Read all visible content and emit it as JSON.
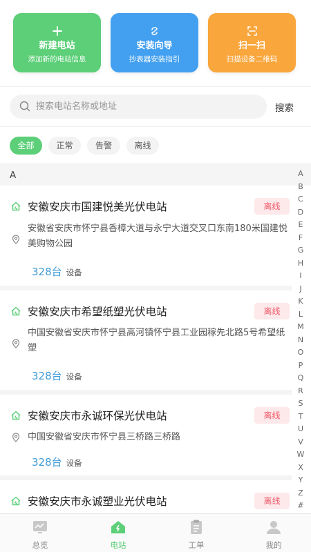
{
  "actions": [
    {
      "title": "新建电站",
      "subtitle": "添加新的电站信息",
      "icon": "plus-icon",
      "color": "#5ccf78"
    },
    {
      "title": "安装向导",
      "subtitle": "抄表器安装指引",
      "icon": "guide-icon",
      "color": "#43a0f0"
    },
    {
      "title": "扫一扫",
      "subtitle": "扫描设备二维码",
      "icon": "scan-icon",
      "color": "#f9a63c"
    }
  ],
  "search": {
    "placeholder": "搜索电站名称或地址",
    "button": "搜索"
  },
  "filters": {
    "all": "全部",
    "normal": "正常",
    "alarm": "告警",
    "offline": "离线",
    "active": "全部"
  },
  "section_letter": "A",
  "stations": [
    {
      "name": "安徽安庆市国建悦美光伏电站",
      "status": "离线",
      "address": "安徽省安庆市怀宁县香樟大道与永宁大道交叉口东南180米国建悦美购物公园",
      "count": "328台",
      "unit": "设备"
    },
    {
      "name": "安徽安庆市希望纸塑光伏电站",
      "status": "离线",
      "address": "中国安徽省安庆市怀宁县高河镇怀宁县工业园稼先北路5号希望纸塑",
      "count": "328台",
      "unit": "设备"
    },
    {
      "name": "安徽安庆市永诚环保光伏电站",
      "status": "离线",
      "address": "中国安徽省安庆市怀宁县三桥路三桥路",
      "count": "328台",
      "unit": "设备"
    },
    {
      "name": "安徽安庆市永诚塑业光伏电站",
      "status": "离线",
      "address": "",
      "count": "",
      "unit": ""
    }
  ],
  "alphabet": [
    "A",
    "B",
    "C",
    "D",
    "E",
    "F",
    "G",
    "H",
    "I",
    "J",
    "K",
    "L",
    "M",
    "N",
    "O",
    "P",
    "Q",
    "R",
    "S",
    "T",
    "U",
    "V",
    "W",
    "X",
    "Y",
    "Z",
    "#"
  ],
  "tabs": {
    "overview": "总览",
    "station": "电站",
    "workorder": "工单",
    "mine": "我的",
    "active": "电站"
  },
  "colors": {
    "accent": "#5ccf78",
    "blue": "#43a0f0",
    "orange": "#f9a63c",
    "offline": "#f05a6a",
    "count": "#3e9ad8"
  }
}
